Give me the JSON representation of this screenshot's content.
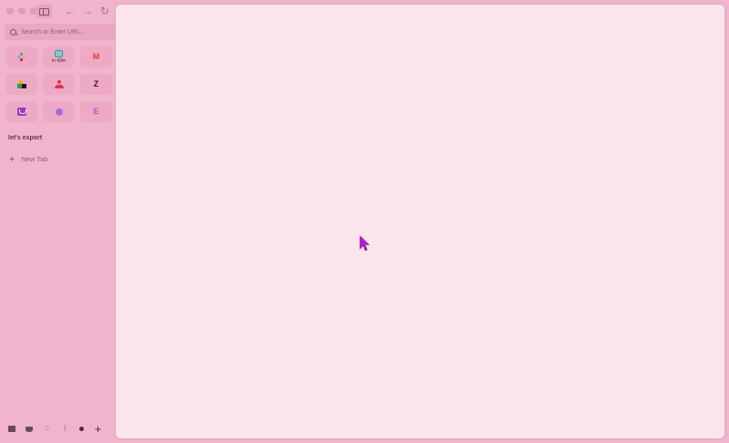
{
  "browser": {
    "search": {
      "placeholder": "Search or Enter URL..."
    },
    "pinned_apps": [
      {
        "name": "slack-icon",
        "sub": ""
      },
      {
        "name": "google-meet-icon",
        "sub": "in 43m"
      },
      {
        "name": "gmail-icon",
        "sub": ""
      },
      {
        "name": "shapes-icon",
        "sub": ""
      },
      {
        "name": "person-icon",
        "sub": ""
      },
      {
        "name": "zendesk-icon",
        "sub": ""
      },
      {
        "name": "vessel-icon",
        "sub": ""
      },
      {
        "name": "orb-icon",
        "sub": ""
      },
      {
        "name": "letter-e-icon",
        "sub": ""
      }
    ],
    "space_title": "let's export",
    "new_tab_label": "New Tab",
    "colors": {
      "sidebar": "#f0b4cc",
      "content": "#fce6ee",
      "cursor": "#b41ed2"
    }
  }
}
